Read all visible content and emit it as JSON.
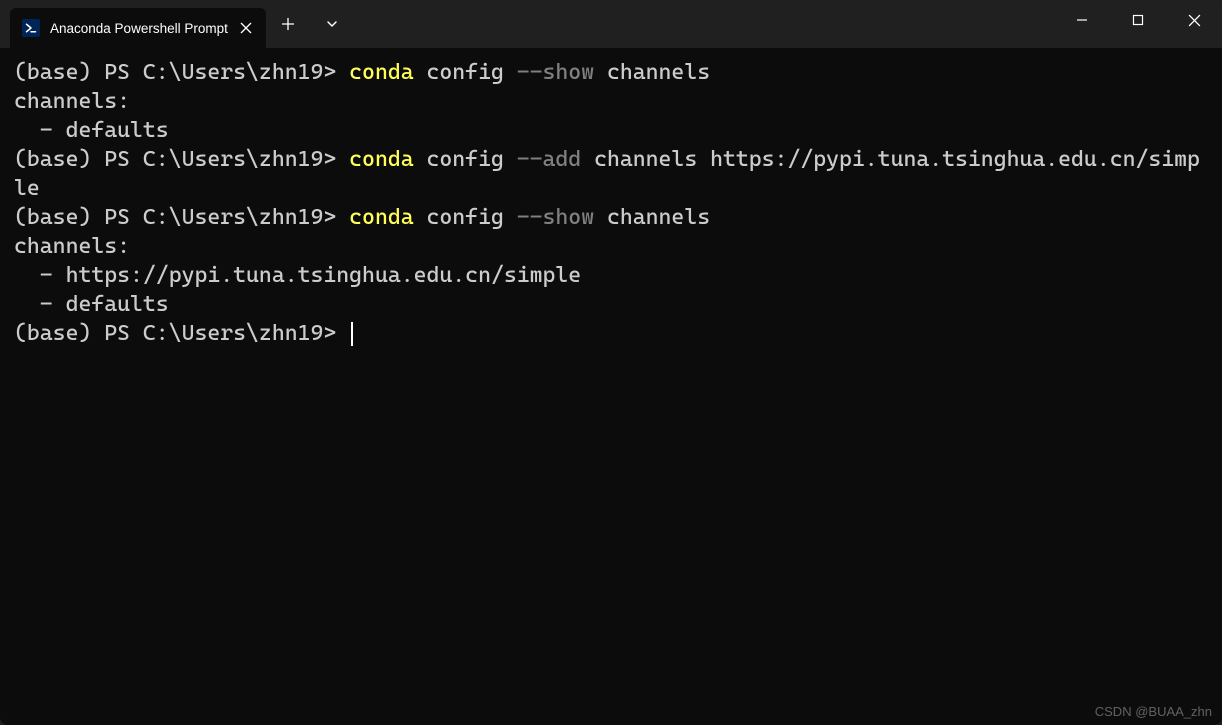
{
  "titlebar": {
    "tab_title": "Anaconda Powershell Prompt",
    "icon_name": "powershell-icon"
  },
  "terminal": {
    "lines": [
      {
        "type": "command",
        "prompt": "(base) PS C:\\Users\\zhn19> ",
        "tokens": [
          {
            "text": "conda",
            "cls": "tok-cmd"
          },
          {
            "text": " ",
            "cls": ""
          },
          {
            "text": "config",
            "cls": "tok-arg"
          },
          {
            "text": " ",
            "cls": ""
          },
          {
            "text": "--show",
            "cls": "tok-flag"
          },
          {
            "text": " ",
            "cls": ""
          },
          {
            "text": "channels",
            "cls": "tok-arg"
          }
        ]
      },
      {
        "type": "output",
        "text": "channels:"
      },
      {
        "type": "output",
        "text": "  - defaults"
      },
      {
        "type": "command",
        "prompt": "(base) PS C:\\Users\\zhn19> ",
        "tokens": [
          {
            "text": "conda",
            "cls": "tok-cmd"
          },
          {
            "text": " ",
            "cls": ""
          },
          {
            "text": "config",
            "cls": "tok-arg"
          },
          {
            "text": " ",
            "cls": ""
          },
          {
            "text": "--add",
            "cls": "tok-flag"
          },
          {
            "text": " ",
            "cls": ""
          },
          {
            "text": "channels",
            "cls": "tok-arg"
          },
          {
            "text": " ",
            "cls": ""
          },
          {
            "text": "https://pypi.tuna.tsinghua.edu.cn/simple",
            "cls": "tok-arg"
          }
        ]
      },
      {
        "type": "command",
        "prompt": "(base) PS C:\\Users\\zhn19> ",
        "tokens": [
          {
            "text": "conda",
            "cls": "tok-cmd"
          },
          {
            "text": " ",
            "cls": ""
          },
          {
            "text": "config",
            "cls": "tok-arg"
          },
          {
            "text": " ",
            "cls": ""
          },
          {
            "text": "--show",
            "cls": "tok-flag"
          },
          {
            "text": " ",
            "cls": ""
          },
          {
            "text": "channels",
            "cls": "tok-arg"
          }
        ]
      },
      {
        "type": "output",
        "text": "channels:"
      },
      {
        "type": "output",
        "text": "  - https://pypi.tuna.tsinghua.edu.cn/simple"
      },
      {
        "type": "output",
        "text": "  - defaults"
      },
      {
        "type": "command",
        "prompt": "(base) PS C:\\Users\\zhn19> ",
        "tokens": [],
        "cursor": true
      }
    ]
  },
  "watermark": "CSDN @BUAA_zhn"
}
